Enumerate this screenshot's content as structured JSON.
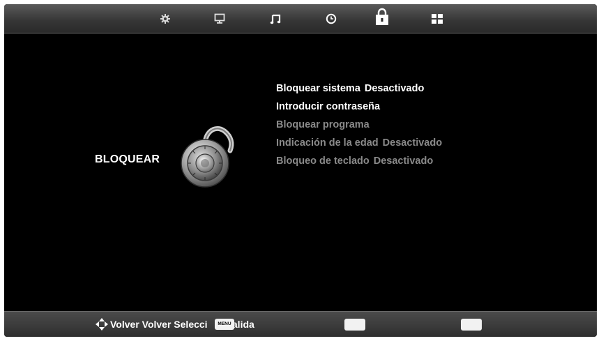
{
  "tabs": [
    {
      "icon": "gear-icon"
    },
    {
      "icon": "monitor-icon"
    },
    {
      "icon": "music-note-icon"
    },
    {
      "icon": "clock-icon"
    },
    {
      "icon": "lock-icon",
      "active": true
    },
    {
      "icon": "grid-icon"
    }
  ],
  "section": {
    "title": "BLOQUEAR",
    "illustration": "padlock-icon"
  },
  "menu": {
    "items": [
      {
        "label": "Bloquear sistema",
        "value": "Desactivado",
        "enabled": true
      },
      {
        "label": "Introducir contraseña",
        "value": "",
        "enabled": true
      },
      {
        "label": "Bloquear programa",
        "value": "",
        "enabled": false
      },
      {
        "label": "Indicación de la edad",
        "value": "Desactivado",
        "enabled": false
      },
      {
        "label": "Bloqueo de teclado",
        "value": "Desactivado",
        "enabled": false
      }
    ]
  },
  "footer": {
    "hint": "Volver Volver Selecci",
    "menu_key": "MENU",
    "exit_label": "Salida"
  },
  "colors": {
    "background": "#000000",
    "text_enabled": "#ffffff",
    "text_disabled": "#8a8a8a",
    "bar": "#3a3a3a"
  }
}
